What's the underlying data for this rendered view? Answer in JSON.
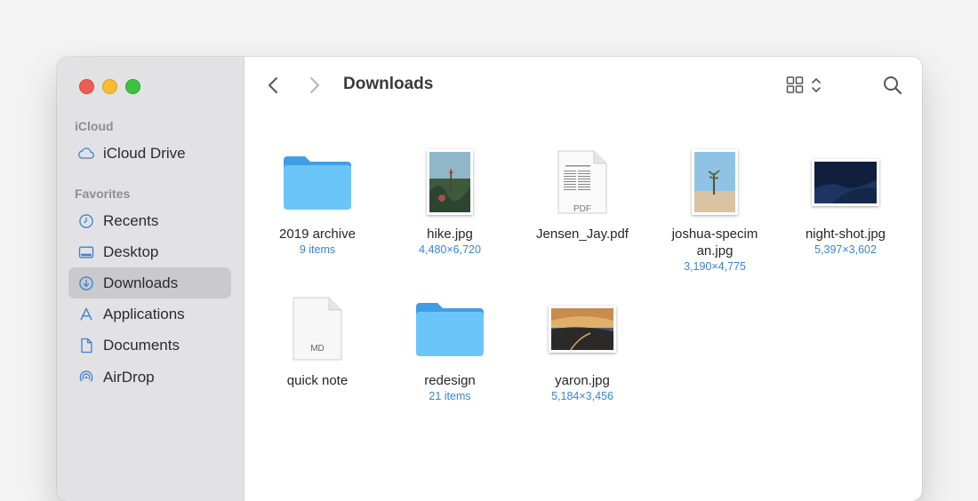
{
  "window": {
    "title": "Downloads"
  },
  "sidebar": {
    "sections": [
      {
        "label": "iCloud",
        "items": [
          {
            "label": "iCloud Drive",
            "icon": "cloud-icon"
          }
        ]
      },
      {
        "label": "Favorites",
        "items": [
          {
            "label": "Recents",
            "icon": "clock-icon"
          },
          {
            "label": "Desktop",
            "icon": "desktop-icon"
          },
          {
            "label": "Downloads",
            "icon": "download-icon",
            "active": true
          },
          {
            "label": "Applications",
            "icon": "applications-icon"
          },
          {
            "label": "Documents",
            "icon": "document-icon"
          },
          {
            "label": "AirDrop",
            "icon": "airdrop-icon"
          }
        ]
      }
    ]
  },
  "files": [
    {
      "name": "2019 archive",
      "sub": "9 items",
      "kind": "folder"
    },
    {
      "name": "hike.jpg",
      "sub": "4,480×6,720",
      "kind": "image"
    },
    {
      "name": "Jensen_Jay.pdf",
      "sub": "",
      "kind": "pdf",
      "badge": "PDF"
    },
    {
      "name": "joshua-speciman.jpg",
      "sub": "3,190×4,775",
      "kind": "image"
    },
    {
      "name": "night-shot.jpg",
      "sub": "5,397×3,602",
      "kind": "image"
    },
    {
      "name": "quick note",
      "sub": "",
      "kind": "markdown",
      "badge": "MD"
    },
    {
      "name": "redesign",
      "sub": "21 items",
      "kind": "folder"
    },
    {
      "name": "yaron.jpg",
      "sub": "5,184×3,456",
      "kind": "image"
    }
  ],
  "colors": {
    "accent": "#3b82d6",
    "folder": "#5fb8f2",
    "sidebar": "#e2e2e4"
  }
}
